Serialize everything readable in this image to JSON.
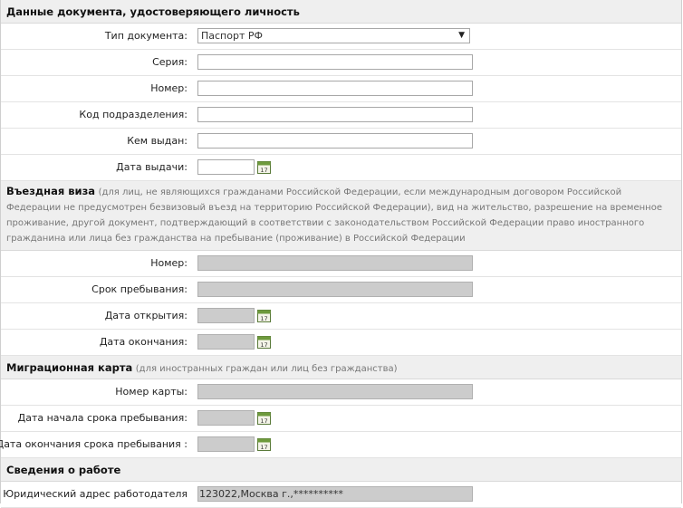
{
  "doc": {
    "title": "Данные документа, удостоверяющего личность",
    "doc_type_label": "Тип документа:",
    "doc_type_value": "Паспорт РФ",
    "series_label": "Серия:",
    "number_label": "Номер:",
    "division_code_label": "Код подразделения:",
    "issued_by_label": "Кем выдан:",
    "issue_date_label": "Дата выдачи:"
  },
  "visa": {
    "title": "Въездная виза",
    "note": "(для лиц, не являющихся гражданами Российской Федерации, если международным договором Российской Федерации не предусмотрен безвизовый въезд на территорию Российской Федерации), вид на жительство, разрешение на временное проживание, другой документ, подтверждающий в соответствии с законодательством Российской Федерации право иностранного гражданина или лица без гражданства на пребывание (проживание) в Российской Федерации",
    "number_label": "Номер:",
    "stay_label": "Срок пребывания:",
    "open_date_label": "Дата открытия:",
    "end_date_label": "Дата окончания:"
  },
  "migration": {
    "title": "Миграционная карта",
    "note": "(для иностранных граждан или лиц без гражданства)",
    "card_number_label": "Номер карты:",
    "stay_start_label": "Дата начала срока пребывания:",
    "stay_end_label": "Дата окончания срока пребывания :"
  },
  "work": {
    "title": "Сведения о работе",
    "employer_address_label": "Юридический адрес работодателя",
    "employer_address_value": "123022,Москва г.,**********"
  },
  "icons": {
    "calendar": "calendar-icon",
    "calendar_day": "17"
  }
}
